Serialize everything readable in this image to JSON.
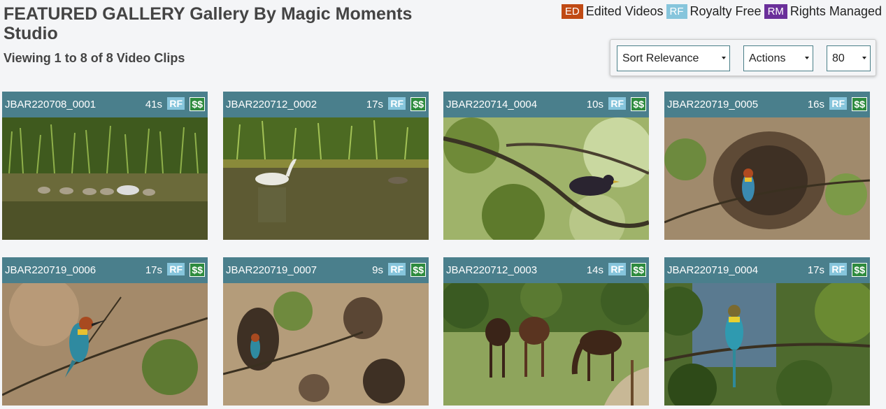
{
  "header": {
    "title": "FEATURED GALLERY Gallery By Magic Moments Studio",
    "subtitle": "Viewing 1 to 8 of 8 Video Clips"
  },
  "legend": {
    "ed_tag": "ED",
    "ed_label": "Edited Videos",
    "rf_tag": "RF",
    "rf_label": "Royalty Free",
    "rm_tag": "RM",
    "rm_label": "Rights Managed"
  },
  "controls": {
    "sort": "Sort Relevance",
    "actions": "Actions",
    "per_page": "80"
  },
  "clips": [
    {
      "id": "JBAR220708_0001",
      "duration": "41s",
      "rf": "RF",
      "price": "$$",
      "scene": "swans-family-lake"
    },
    {
      "id": "JBAR220712_0002",
      "duration": "17s",
      "rf": "RF",
      "price": "$$",
      "scene": "swan-reeds-lake"
    },
    {
      "id": "JBAR220714_0004",
      "duration": "10s",
      "rf": "RF",
      "price": "$$",
      "scene": "starling-on-branch"
    },
    {
      "id": "JBAR220719_0005",
      "duration": "16s",
      "rf": "RF",
      "price": "$$",
      "scene": "bee-eater-sand-wall"
    },
    {
      "id": "JBAR220719_0006",
      "duration": "17s",
      "rf": "RF",
      "price": "$$",
      "scene": "bee-eater-branch"
    },
    {
      "id": "JBAR220719_0007",
      "duration": "9s",
      "rf": "RF",
      "price": "$$",
      "scene": "bee-eater-nest-holes"
    },
    {
      "id": "JBAR220712_0003",
      "duration": "14s",
      "rf": "RF",
      "price": "$$",
      "scene": "horses-grazing"
    },
    {
      "id": "JBAR220719_0004",
      "duration": "17s",
      "rf": "RF",
      "price": "$$",
      "scene": "bee-eater-perched"
    }
  ]
}
